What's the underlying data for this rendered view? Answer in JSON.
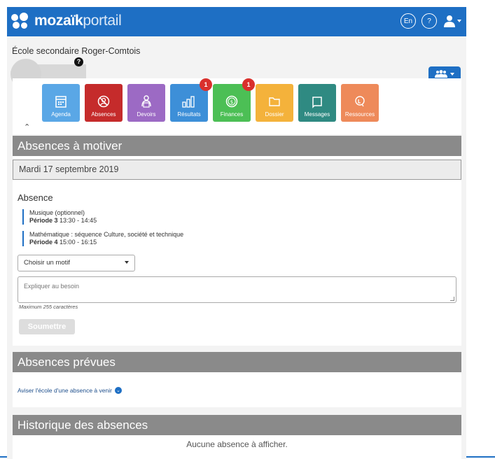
{
  "header": {
    "brand_bold": "mozaïk",
    "brand_light": "portail",
    "lang_label": "En",
    "help_label": "?"
  },
  "school": {
    "name": "École secondaire Roger-Comtois",
    "help_badge": "?"
  },
  "tiles": [
    {
      "label": "Agenda",
      "color": "#5aa7e6",
      "icon": "calendar-icon",
      "badge": ""
    },
    {
      "label": "Absences",
      "color": "#c52b2b",
      "icon": "absences-icon",
      "badge": ""
    },
    {
      "label": "Devoirs",
      "color": "#9c6ac4",
      "icon": "homework-icon",
      "badge": ""
    },
    {
      "label": "Résultats",
      "color": "#3d8fd8",
      "icon": "chart-icon",
      "badge": "1"
    },
    {
      "label": "Finances",
      "color": "#4cbf55",
      "icon": "money-icon",
      "badge": "1"
    },
    {
      "label": "Dossier",
      "color": "#f4b23b",
      "icon": "folder-icon",
      "badge": ""
    },
    {
      "label": "Messages",
      "color": "#2f8a82",
      "icon": "messages-icon",
      "badge": ""
    },
    {
      "label": "Ressources",
      "color": "#ee8a5a",
      "icon": "resources-icon",
      "badge": ""
    }
  ],
  "absences_to_justify": {
    "title": "Absences à motiver",
    "date": "Mardi 17 septembre 2019",
    "absence_title": "Absence",
    "courses": [
      {
        "name": "Musique (optionnel)",
        "period": "Période 3",
        "time": "13:30 - 14:45"
      },
      {
        "name": "Mathématique : séquence Culture, société et technique",
        "period": "Période 4",
        "time": "15:00 - 16:15"
      }
    ],
    "reason_select": "Choisir un motif",
    "explain_placeholder": "Expliquer au besoin",
    "max_chars": "Maximum 255 caractères",
    "submit_label": "Soumettre"
  },
  "planned_absences": {
    "title": "Absences prévues",
    "link": "Aviser l'école d'une absence à venir"
  },
  "history": {
    "title": "Historique des absences",
    "empty": "Aucune absence à afficher."
  }
}
